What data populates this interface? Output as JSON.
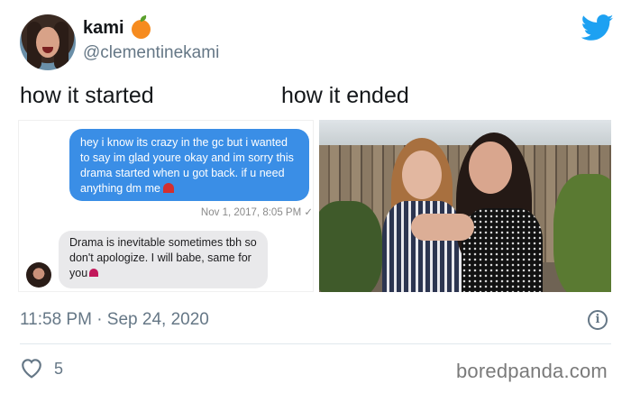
{
  "tweet": {
    "display_name": "kami",
    "name_emoji": "orange-emoji",
    "handle": "@clementinekami",
    "caption_left": "how it started",
    "caption_right": "how it ended",
    "timestamp": "11:58 PM · Sep 24, 2020",
    "likes": "5"
  },
  "chat": {
    "outgoing_message": "hey i know its crazy in the gc but i wanted to say im glad youre okay and im sorry this drama started when u got back. if u need anything dm me",
    "outgoing_timestamp": "Nov 1, 2017, 8:05 PM ✓",
    "incoming_message": "Drama is inevitable sometimes tbh so don't apologize. I will babe, same for you"
  },
  "watermark": "boredpanda.com",
  "colors": {
    "twitter_blue": "#1da1f2",
    "bubble_blue": "#3a8ee6",
    "bubble_gray": "#e9e9eb",
    "secondary_text": "#657786"
  },
  "icons": [
    "twitter-bird-icon",
    "info-icon",
    "heart-icon",
    "orange-emoji"
  ]
}
